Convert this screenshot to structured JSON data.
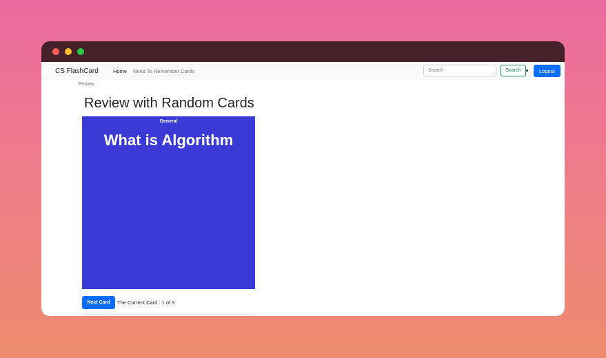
{
  "window": {
    "controls": [
      "close",
      "minimize",
      "maximize"
    ]
  },
  "navbar": {
    "brand": "CS FlashCard",
    "links": [
      {
        "label": "Home"
      },
      {
        "label": "Need To Remember Cards"
      }
    ],
    "search": {
      "placeholder": "Search",
      "button_label": "Search"
    },
    "logout_label": "Logout"
  },
  "breadcrumb": "Review",
  "page_title": "Review with Random Cards",
  "card": {
    "category": "General",
    "question": "What is Algorithm",
    "color": "#3a3ad6"
  },
  "next_button_label": "Next Card",
  "counter_text": "The Current Card : 1 of 5",
  "colors": {
    "titlebar": "#46212a",
    "primary": "#0d6efd",
    "success": "#198754"
  }
}
